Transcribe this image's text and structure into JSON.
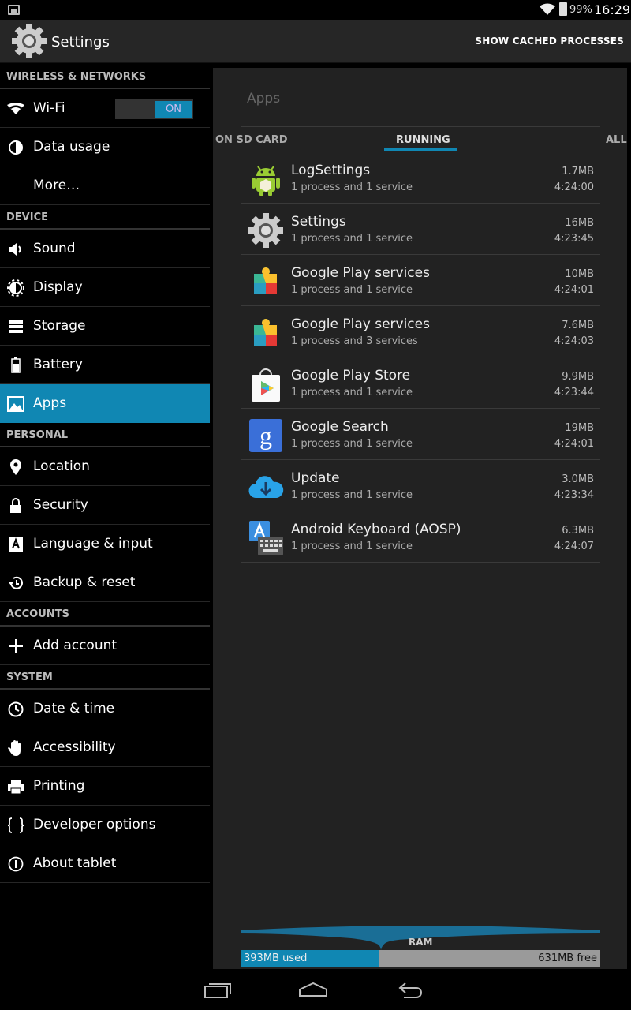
{
  "status": {
    "battery": "99%",
    "time": "16:29"
  },
  "actionbar": {
    "title": "Settings",
    "cached_label": "SHOW CACHED PROCESSES"
  },
  "sidebar": {
    "sections": [
      {
        "label": "WIRELESS & NETWORKS",
        "items": [
          {
            "label": "Wi-Fi",
            "icon": "wifi-icon",
            "toggle": "ON"
          },
          {
            "label": "Data usage",
            "icon": "data-usage-icon"
          },
          {
            "label": "More…",
            "icon": ""
          }
        ]
      },
      {
        "label": "DEVICE",
        "items": [
          {
            "label": "Sound",
            "icon": "sound-icon"
          },
          {
            "label": "Display",
            "icon": "display-icon"
          },
          {
            "label": "Storage",
            "icon": "storage-icon"
          },
          {
            "label": "Battery",
            "icon": "battery-icon"
          },
          {
            "label": "Apps",
            "icon": "apps-icon",
            "active": true
          }
        ]
      },
      {
        "label": "PERSONAL",
        "items": [
          {
            "label": "Location",
            "icon": "location-icon"
          },
          {
            "label": "Security",
            "icon": "lock-icon"
          },
          {
            "label": "Language & input",
            "icon": "language-icon"
          },
          {
            "label": "Backup & reset",
            "icon": "backup-icon"
          }
        ]
      },
      {
        "label": "ACCOUNTS",
        "items": [
          {
            "label": "Add account",
            "icon": "plus-icon"
          }
        ]
      },
      {
        "label": "SYSTEM",
        "items": [
          {
            "label": "Date & time",
            "icon": "clock-icon"
          },
          {
            "label": "Accessibility",
            "icon": "hand-icon"
          },
          {
            "label": "Printing",
            "icon": "printer-icon"
          },
          {
            "label": "Developer options",
            "icon": "braces-icon"
          },
          {
            "label": "About tablet",
            "icon": "info-icon"
          }
        ]
      }
    ]
  },
  "content": {
    "header": "Apps",
    "tabs": [
      "ON SD CARD",
      "RUNNING",
      "ALL"
    ],
    "apps": [
      {
        "name": "LogSettings",
        "sub": "1 process and 1 service",
        "size": "1.7MB",
        "time": "4:24:00",
        "icon": "android-icon"
      },
      {
        "name": "Settings",
        "sub": "1 process and 1 service",
        "size": "16MB",
        "time": "4:23:45",
        "icon": "gear-icon"
      },
      {
        "name": "Google Play services",
        "sub": "1 process and 1 service",
        "size": "10MB",
        "time": "4:24:01",
        "icon": "puzzle-icon"
      },
      {
        "name": "Google Play services",
        "sub": "1 process and 3 services",
        "size": "7.6MB",
        "time": "4:24:03",
        "icon": "puzzle-icon"
      },
      {
        "name": "Google Play Store",
        "sub": "1 process and 1 service",
        "size": "9.9MB",
        "time": "4:23:44",
        "icon": "play-store-icon"
      },
      {
        "name": "Google Search",
        "sub": "1 process and 1 service",
        "size": "19MB",
        "time": "4:24:01",
        "icon": "google-search-icon"
      },
      {
        "name": "Update",
        "sub": "1 process and 1 service",
        "size": "3.0MB",
        "time": "4:23:34",
        "icon": "cloud-download-icon"
      },
      {
        "name": "Android Keyboard (AOSP)",
        "sub": "1 process and 1 service",
        "size": "6.3MB",
        "time": "4:24:07",
        "icon": "keyboard-icon"
      }
    ],
    "ram": {
      "label": "RAM",
      "used": "393MB used",
      "free": "631MB free"
    }
  }
}
